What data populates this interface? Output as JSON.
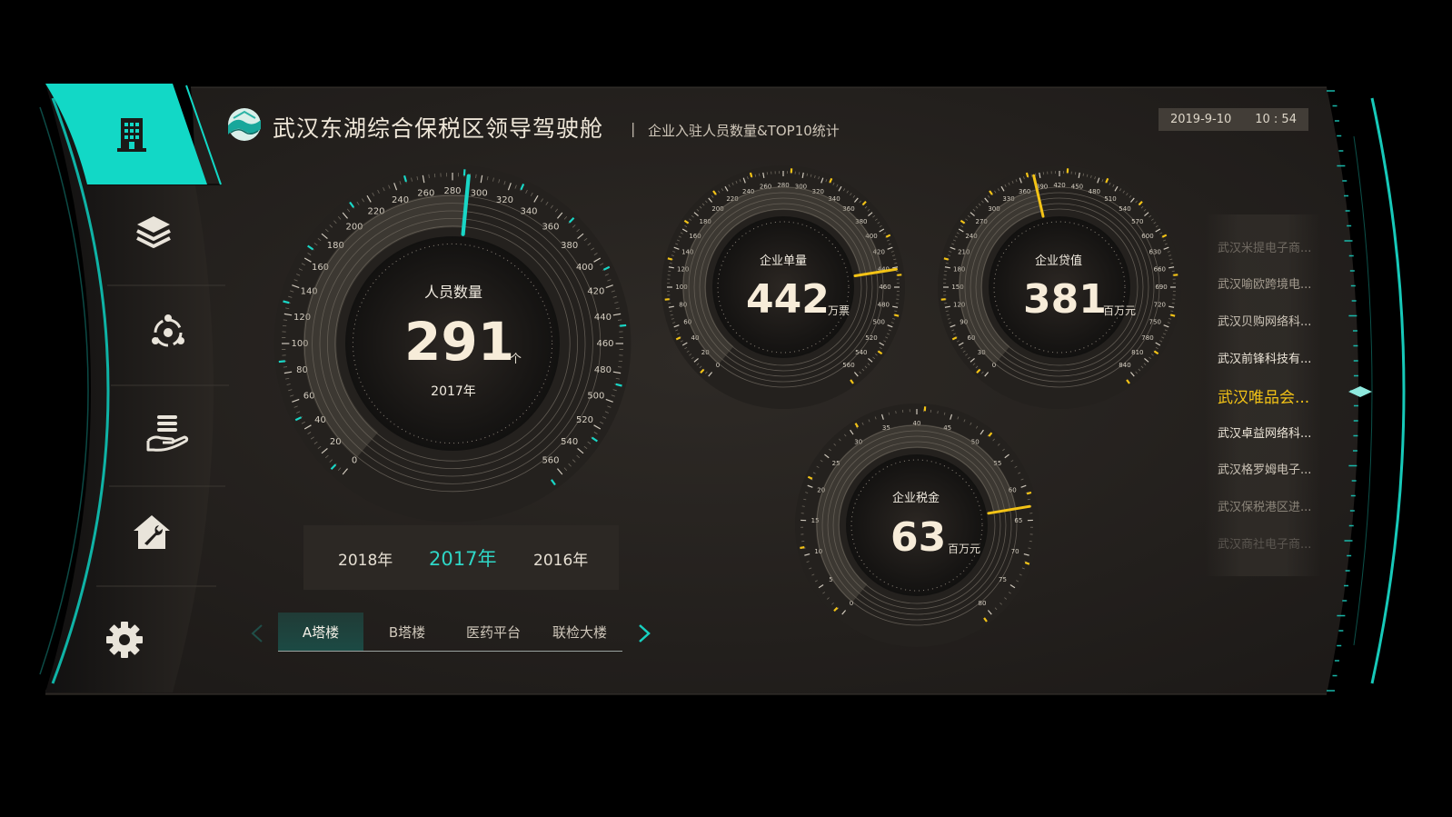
{
  "header": {
    "title": "武汉东湖综合保税区领导驾驶舱",
    "divider": "|",
    "subtitle": "企业入驻人员数量&TOP10统计",
    "date": "2019-9-10",
    "time": "10 : 54"
  },
  "sidebar": {
    "items": [
      {
        "icon": "building-icon",
        "active": true
      },
      {
        "icon": "layers-icon",
        "active": false
      },
      {
        "icon": "network-icon",
        "active": false
      },
      {
        "icon": "hand-money-icon",
        "active": false
      },
      {
        "icon": "house-wrench-icon",
        "active": false
      },
      {
        "icon": "gear-icon",
        "active": false
      }
    ]
  },
  "main_gauge": {
    "label": "人员数量",
    "value": "291",
    "unit": "个",
    "year": "2017年",
    "ticks": [
      "0",
      "20",
      "40",
      "60",
      "80",
      "100",
      "120",
      "140",
      "160",
      "180",
      "200",
      "220",
      "240",
      "260",
      "280",
      "300",
      "320",
      "340",
      "360",
      "380",
      "400",
      "420",
      "440",
      "460",
      "480",
      "500",
      "520",
      "540",
      "560"
    ],
    "pointer_value": 291,
    "max": 560
  },
  "gauges": [
    {
      "label": "企业单量",
      "value": "442",
      "unit": "万票",
      "ticks": [
        "0",
        "20",
        "40",
        "60",
        "80",
        "100",
        "120",
        "140",
        "160",
        "180",
        "200",
        "220",
        "240",
        "260",
        "280",
        "300",
        "320",
        "340",
        "360",
        "380",
        "400",
        "420",
        "440",
        "460",
        "480",
        "500",
        "520",
        "540",
        "560"
      ],
      "pointer_value": 442,
      "max": 560
    },
    {
      "label": "企业贷值",
      "value": "381",
      "unit": "百万元",
      "ticks": [
        "0",
        "30",
        "60",
        "90",
        "120",
        "150",
        "180",
        "210",
        "240",
        "270",
        "300",
        "330",
        "360",
        "390",
        "420",
        "450",
        "480",
        "510",
        "540",
        "570",
        "600",
        "630",
        "660",
        "690",
        "720",
        "750",
        "780",
        "810",
        "840"
      ],
      "pointer_value": 381,
      "max": 840
    },
    {
      "label": "企业税金",
      "value": "63",
      "unit": "百万元",
      "ticks": [
        "0",
        "5",
        "10",
        "15",
        "20",
        "25",
        "30",
        "35",
        "40",
        "45",
        "50",
        "55",
        "60",
        "65",
        "70",
        "75",
        "80"
      ],
      "pointer_value": 63,
      "max": 80
    }
  ],
  "years": {
    "items": [
      "2018年",
      "2017年",
      "2016年"
    ],
    "selected": "2017年"
  },
  "tabs": {
    "items": [
      "A塔楼",
      "B塔楼",
      "医药平台",
      "联检大楼"
    ],
    "selected": "A塔楼"
  },
  "company_list": {
    "items": [
      "武汉米提电子商...",
      "武汉喻欧跨境电...",
      "武汉贝购网络科...",
      "武汉前锋科技有...",
      "武汉唯品会...",
      "武汉卓益网络科...",
      "武汉格罗姆电子...",
      "武汉保税港区进...",
      "武汉商社电子商..."
    ],
    "selected": "武汉唯品会..."
  },
  "colors": {
    "accent": "#13d3c3",
    "gauge_pointer_main": "#19d6c6",
    "gauge_pointer_small": "#f3c316",
    "panel": "#26221f",
    "text_primary": "#f2ece0"
  }
}
